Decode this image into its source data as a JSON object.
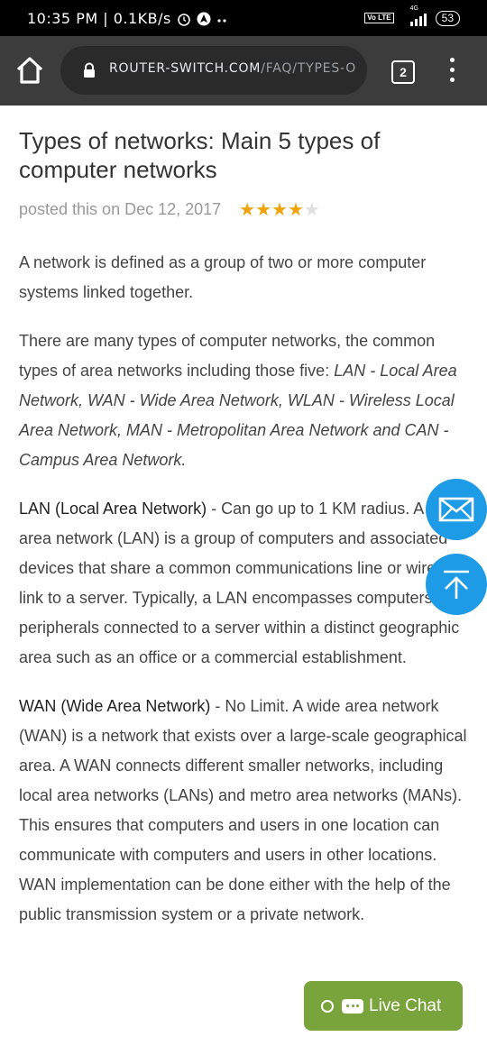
{
  "status": {
    "time_speed": "10:35 PM | 0.1KB/s",
    "network": "4G",
    "volte": "Vo LTE",
    "battery": "53"
  },
  "browser": {
    "url_domain": "ROUTER-SWITCH.COM",
    "url_path": "/FAQ/TYPES-O",
    "tab_count": "2"
  },
  "article": {
    "title": "Types of networks: Main 5 types of computer networks",
    "posted": "posted this on Dec 12, 2017",
    "rating": 4,
    "rating_max": 5,
    "p1": "A network is defined as a group of two or more computer systems linked together.",
    "p2_text": "There are many types of computer networks, the common types of area networks including those five: ",
    "p2_italic": "LAN - Local Area Network, WAN - Wide Area Network, WLAN - Wireless Local Area Network, MAN - Metropolitan Area Network and CAN - Campus Area Network.",
    "p3_term": "LAN (Local Area Network)",
    "p3_text": " - Can go up to 1 KM radius. A local area network (LAN) is a group of computers and associated devices that share a common communications line or wireless link to a server. Typically, a LAN encompasses computers and peripherals connected to a server within a distinct geographic area such as an office or a commercial establishment.",
    "p4_term": "WAN (Wide Area Network)",
    "p4_text": " - No Limit. A wide area network (WAN) is a network that exists over a large-scale geographical area. A WAN connects different smaller networks, including local area networks (LANs) and metro area networks (MANs). This ensures that computers and users in one location can communicate with computers and users in other locations. WAN implementation can be done either with the help of the public transmission system or a private network."
  },
  "live_chat": {
    "label": "Live Chat"
  },
  "colors": {
    "accent": "#1e9be6",
    "live_chat": "#79a33b",
    "star": "#f0a30a"
  }
}
